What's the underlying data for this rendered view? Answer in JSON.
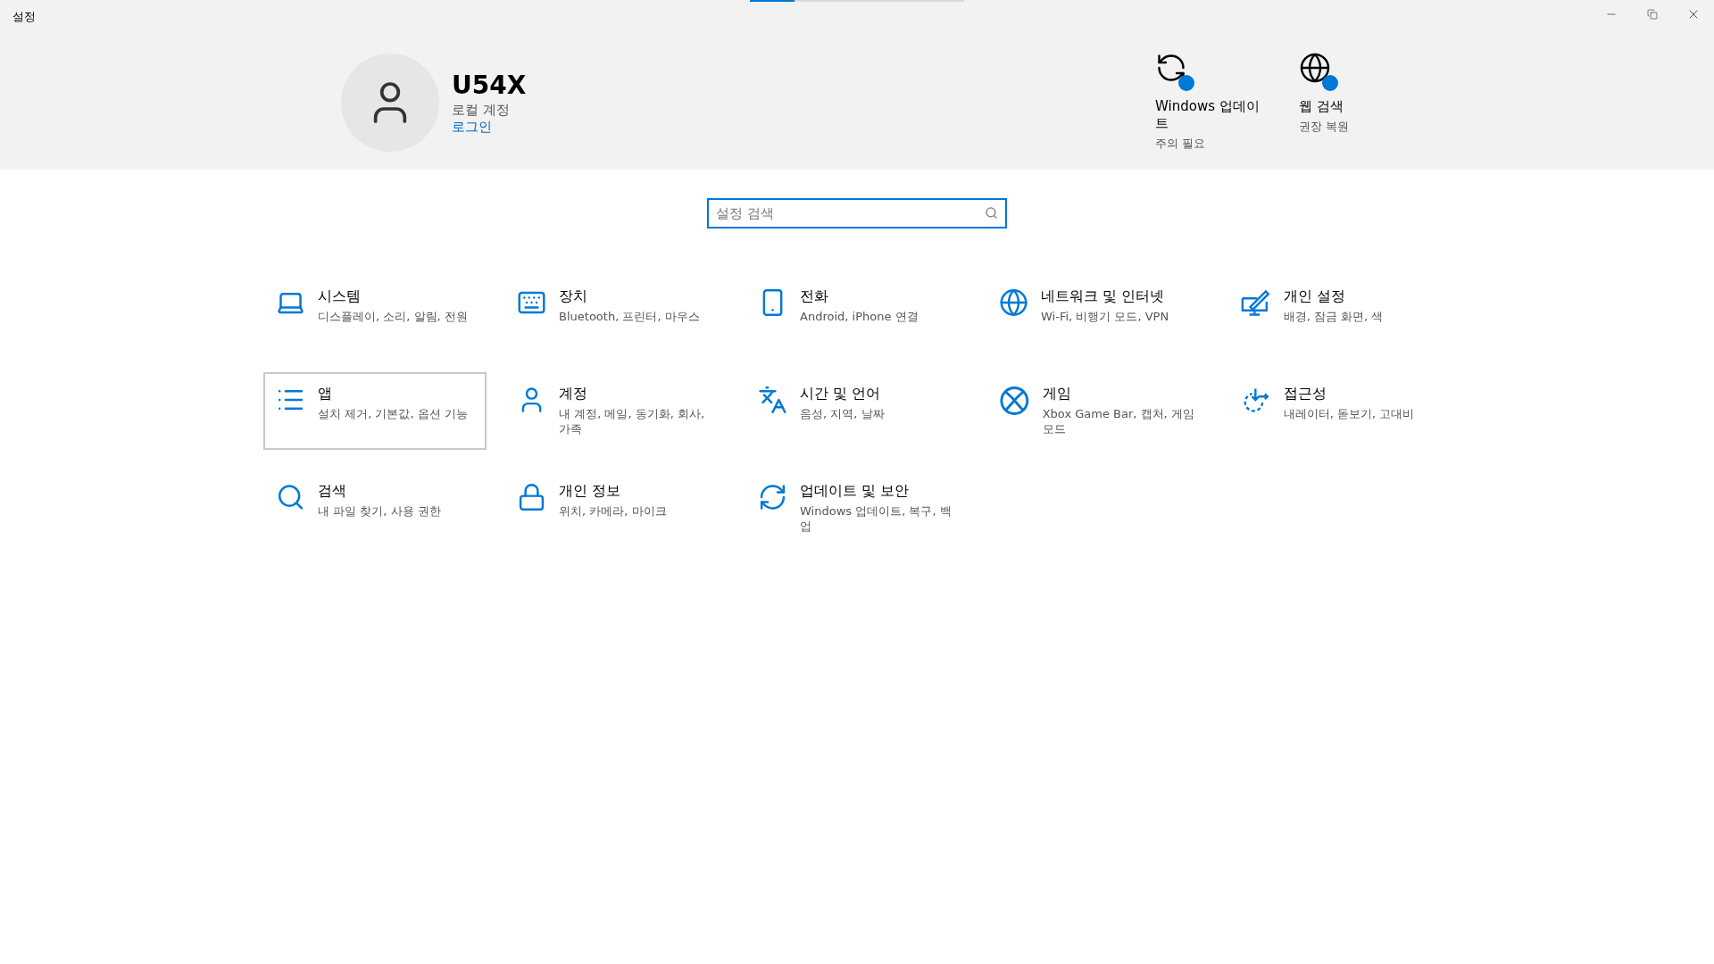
{
  "window": {
    "title": "설정"
  },
  "loading_bar": {
    "level": 0.21
  },
  "account": {
    "name": "U54X",
    "type": "로컬 계정",
    "link": "로그인"
  },
  "status_items": [
    {
      "title": "Windows 업데이트",
      "subtitle": "주의 필요",
      "badge": true
    },
    {
      "title": "웹 검색",
      "subtitle": "권장 복원",
      "badge": true
    }
  ],
  "search": {
    "placeholder": "설정 검색"
  },
  "categories": [
    {
      "title": "시스템",
      "subtitle": "디스플레이, 소리, 알림, 전원",
      "selected": false
    },
    {
      "title": "장치",
      "subtitle": "Bluetooth, 프린터, 마우스",
      "selected": false
    },
    {
      "title": "전화",
      "subtitle": "Android, iPhone 연결",
      "selected": false
    },
    {
      "title": "네트워크 및 인터넷",
      "subtitle": "Wi-Fi, 비행기 모드, VPN",
      "selected": false
    },
    {
      "title": "개인 설정",
      "subtitle": "배경, 잠금 화면, 색",
      "selected": false
    },
    {
      "title": "앱",
      "subtitle": "설치 제거, 기본값, 옵션 기능",
      "selected": true
    },
    {
      "title": "계정",
      "subtitle": "내 계정, 메일, 동기화, 회사, 가족",
      "selected": false
    },
    {
      "title": "시간 및 언어",
      "subtitle": "음성, 지역, 날짜",
      "selected": false
    },
    {
      "title": "게임",
      "subtitle": "Xbox Game Bar, 캡처, 게임 모드",
      "selected": false
    },
    {
      "title": "접근성",
      "subtitle": "내레이터, 돋보기, 고대비",
      "selected": false
    },
    {
      "title": "검색",
      "subtitle": "내 파일 찾기, 사용 권한",
      "selected": false
    },
    {
      "title": "개인 정보",
      "subtitle": "위치, 카메라, 마이크",
      "selected": false
    },
    {
      "title": "업데이트 및 보안",
      "subtitle": "Windows 업데이트, 복구, 백업",
      "selected": false
    }
  ]
}
